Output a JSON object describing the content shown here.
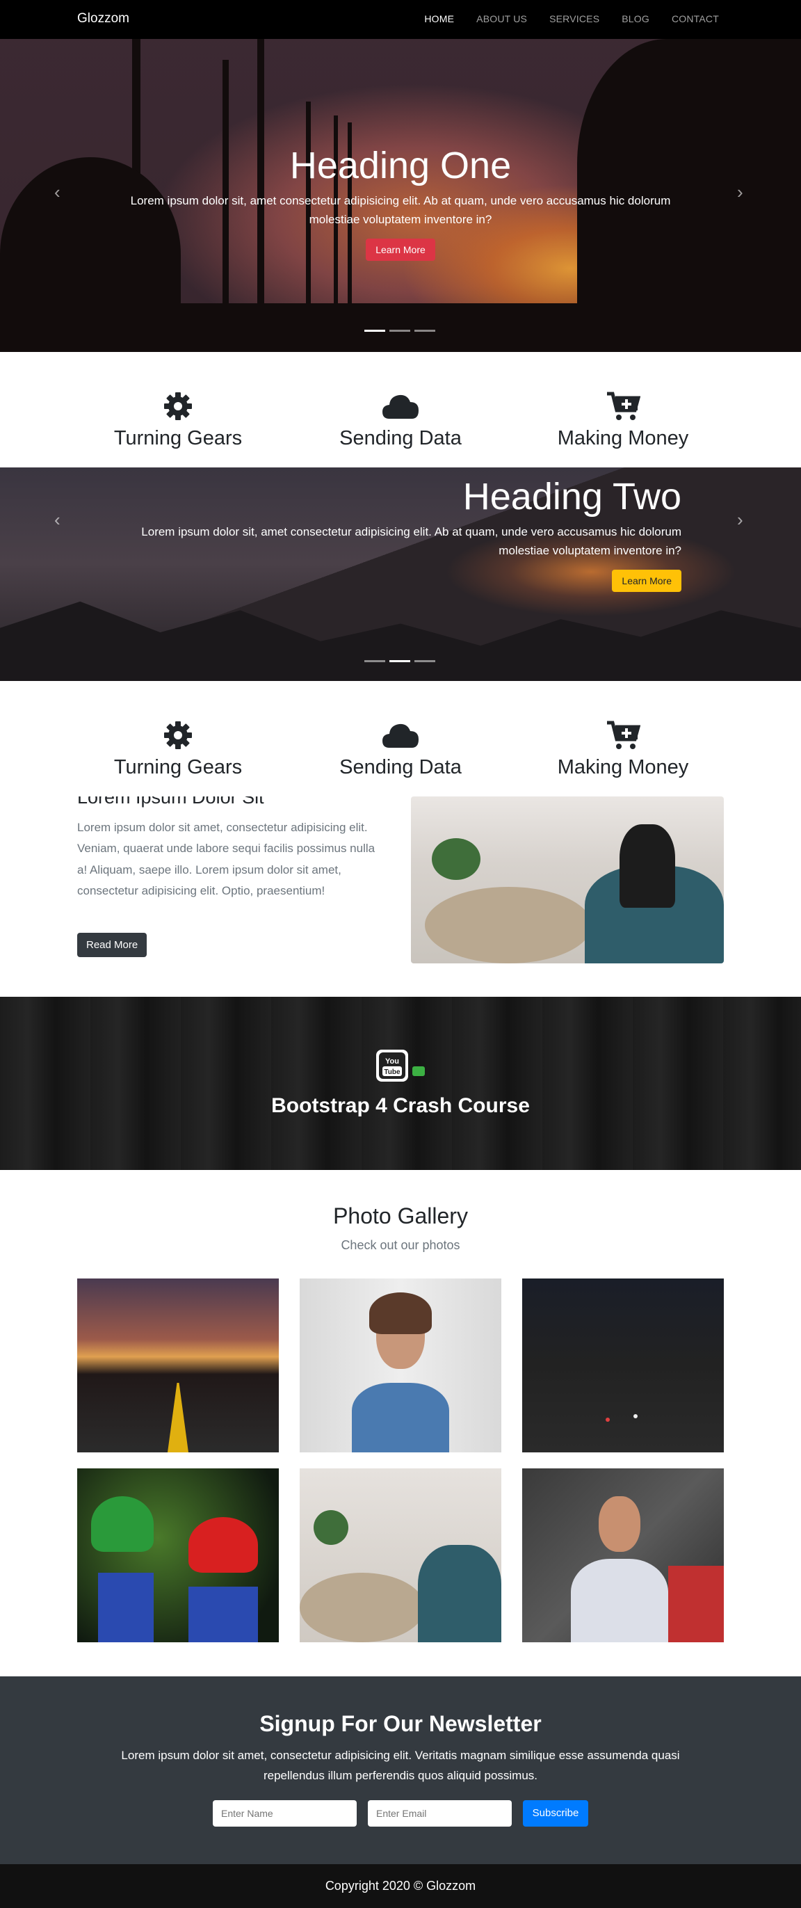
{
  "nav": {
    "brand": "Glozzom",
    "links": [
      "HOME",
      "ABOUT US",
      "SERVICES",
      "BLOG",
      "CONTACT"
    ]
  },
  "slides": [
    {
      "heading": "Heading One",
      "text": "Lorem ipsum dolor sit, amet consectetur adipisicing elit. Ab at quam, unde vero accusamus hic dolorum molestiae voluptatem inventore in?",
      "button": "Learn More"
    },
    {
      "heading": "Heading Two",
      "text": "Lorem ipsum dolor sit, amet consectetur adipisicing elit. Ab at quam, unde vero accusamus hic dolorum molestiae voluptatem inventore in?",
      "button": "Learn More"
    }
  ],
  "features": [
    {
      "title": "Turning Gears",
      "icon": "gear-icon"
    },
    {
      "title": "Sending Data",
      "icon": "cloud-icon"
    },
    {
      "title": "Making Money",
      "icon": "cart-plus-icon"
    }
  ],
  "about": {
    "title": "Lorem Ipsum Dolor Sit",
    "text": "Lorem ipsum dolor sit amet, consectetur adipisicing elit. Veniam, quaerat unde labore sequi facilis possimus nulla a! Aliquam, saepe illo. Lorem ipsum dolor sit amet, consectetur adipisicing elit. Optio, praesentium!",
    "button": "Read More"
  },
  "video": {
    "title": "Bootstrap 4 Crash Course",
    "icon": "youtube-icon"
  },
  "gallery": {
    "title": "Photo Gallery",
    "subtitle": "Check out our photos"
  },
  "newsletter": {
    "title": "Signup For Our Newsletter",
    "text": "Lorem ipsum dolor sit amet, consectetur adipisicing elit. Veritatis magnam similique esse assumenda quasi repellendus illum perferendis quos aliquid possimus.",
    "name_placeholder": "Enter Name",
    "email_placeholder": "Enter Email",
    "button": "Subscribe"
  },
  "footer": {
    "copyright": "Copyright 2020 © Glozzom"
  }
}
